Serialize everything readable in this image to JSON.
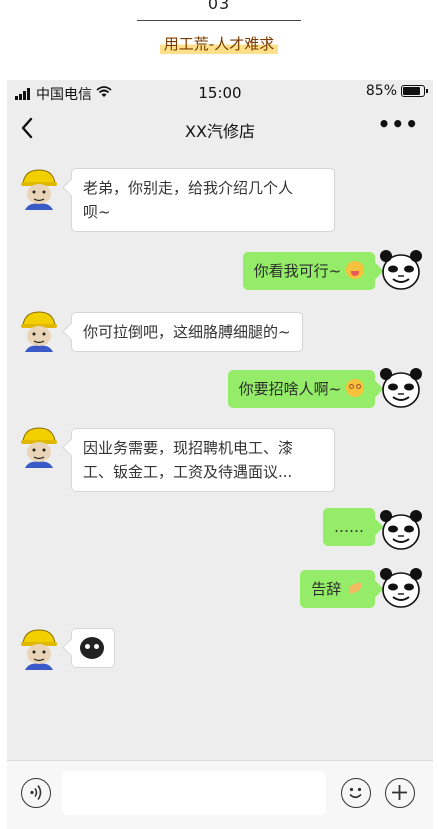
{
  "page": {
    "number": "03",
    "caption": "用工荒-人才难求"
  },
  "status_bar": {
    "carrier": "中国电信",
    "time": "15:00",
    "battery": "85%",
    "battery_level": 0.85
  },
  "nav": {
    "title": "XX汽修店",
    "more": "•••"
  },
  "messages": [
    {
      "side": "left",
      "lines": [
        "老弟，你别走，给我介绍几个人",
        "呗~"
      ]
    },
    {
      "side": "right",
      "lines": [
        "你看我可行~"
      ],
      "emoji": "tongue-emoji"
    },
    {
      "side": "left",
      "lines": [
        "你可拉倒吧，这细胳膊细腿的~"
      ]
    },
    {
      "side": "right",
      "lines": [
        "你要招啥人啊~"
      ],
      "emoji": "dizzy-emoji"
    },
    {
      "side": "left",
      "lines": [
        "因业务需要，现招聘机电工、漆",
        "工、钣金工，工资及待遇面议..."
      ]
    },
    {
      "side": "right",
      "lines": [
        "……"
      ]
    },
    {
      "side": "right",
      "lines": [
        "告辞"
      ],
      "emoji": "clap-hands-emoji"
    },
    {
      "side": "left",
      "lines": [],
      "emoji": "black-face-sticker"
    }
  ],
  "colors": {
    "chat_bg": "#ededed",
    "bubble_right": "#95ec69",
    "bubble_left": "#ffffff",
    "caption_highlight": "#ffe08a"
  },
  "icons": {
    "back": "chevron-left-icon",
    "voice": "voice-icon",
    "emoji": "smile-icon",
    "plus": "plus-icon",
    "wifi": "wifi-icon",
    "signal": "signal-icon",
    "battery": "battery-icon"
  }
}
